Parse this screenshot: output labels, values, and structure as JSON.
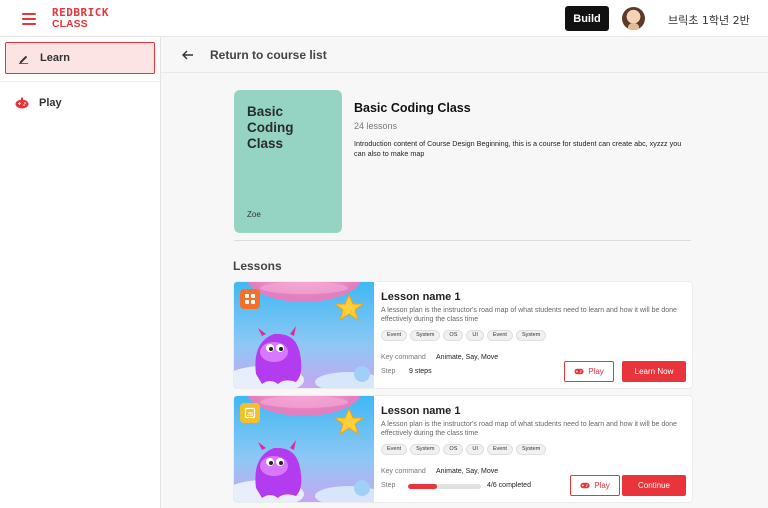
{
  "header": {
    "logo_line1": "REDBRICK",
    "logo_line2": "CLASS",
    "build_label": "Build",
    "username": "브릭초 1학년 2반",
    "accent_color": "#e8343a"
  },
  "sidebar": {
    "items": [
      {
        "label": "Learn",
        "icon": "pencil-icon",
        "active": true
      },
      {
        "label": "Play",
        "icon": "gamepad-icon",
        "active": false
      }
    ]
  },
  "back": {
    "label": "Return to course list",
    "icon": "arrow-left-icon"
  },
  "course": {
    "cover_title": "Basic Coding Class",
    "cover_author": "Zoe",
    "cover_color": "#95d4c2",
    "title": "Basic Coding Class",
    "lesson_count": "24 lessons",
    "description": "Introduction content of Course Design Beginning, this is a course for student can create abc, xyzzz you can also to make map"
  },
  "lessons_heading": "Lessons",
  "lessons": [
    {
      "title": "Lesson name 1",
      "description": "A lesson plan is the instructor's road map of what students need to learn and how it will be done effectively during the class time",
      "tags": [
        "Event",
        "System",
        "OS",
        "UI",
        "Event",
        "System"
      ],
      "key_command_label": "Key command",
      "key_command_value": "Animate, Say, Move",
      "step_label": "Step",
      "step_value": "9 steps",
      "play_label": "Play",
      "action_label": "Learn Now",
      "badge_icon": "blocks-icon"
    },
    {
      "title": "Lesson name 1",
      "description": "A lesson plan is the instructor's road map of what students need to learn and how it will be done effectively during the class time",
      "tags": [
        "Event",
        "System",
        "OS",
        "UI",
        "Event",
        "System"
      ],
      "key_command_label": "Key command",
      "key_command_value": "Animate, Say, Move",
      "step_label": "Step",
      "progress_fraction": 0.4,
      "progress_text": "4/6 completed",
      "play_label": "Play",
      "action_label": "Continue",
      "badge_icon": "js-icon"
    }
  ]
}
